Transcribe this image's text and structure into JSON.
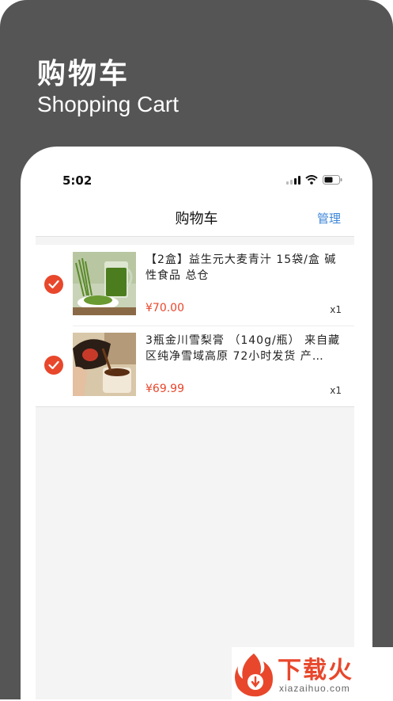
{
  "hero": {
    "title": "购物车",
    "subtitle": "Shopping Cart"
  },
  "status_bar": {
    "time": "5:02"
  },
  "nav": {
    "title": "购物车",
    "manage_label": "管理"
  },
  "cart": {
    "items": [
      {
        "name": "【2盒】益生元大麦青汁 15袋/盒 碱性食品 总仓",
        "price": "¥70.00",
        "quantity": "x1",
        "selected": true,
        "image_icon": "green-juice-image"
      },
      {
        "name": "3瓶金川雪梨膏 （140g/瓶） 来自藏区纯净雪域高原 72小时发货 产…",
        "price": "¥69.99",
        "quantity": "x1",
        "selected": true,
        "image_icon": "pear-syrup-image"
      }
    ]
  },
  "watermark": {
    "brand": "下载火",
    "url": "xiazaihuo.com"
  },
  "colors": {
    "accent": "#e8472c",
    "link": "#3d86d9",
    "frame": "#555555"
  }
}
